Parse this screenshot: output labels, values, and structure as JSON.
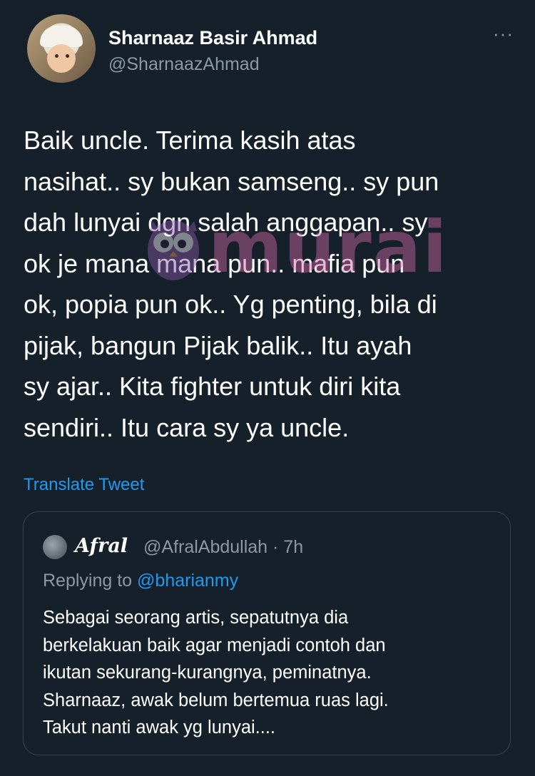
{
  "tweet": {
    "author_name": "Sharnaaz Basir Ahmad",
    "author_handle": "@SharnaazAhmad",
    "more_icon": "more-icon",
    "lines": [
      "Baik uncle. Terima kasih atas",
      "nasihat.. sy bukan samseng.. sy pun",
      "dah lunyai dgn salah anggapan.. sy",
      "ok je mana mana pun.. mafia pun",
      "ok, popia pun ok.. Yg penting, bila di",
      "pijak, bangun Pijak balik.. Itu ayah",
      "sy ajar.. Kita fighter untuk diri kita",
      "sendiri.. Itu cara sy ya uncle."
    ],
    "translate_label": "Translate Tweet"
  },
  "watermark": {
    "text": "murai",
    "color": "#d46ba8"
  },
  "quoted": {
    "author_name": "Afral",
    "author_meta": "@AfralAbdullah · 7h",
    "replying_prefix": "Replying to",
    "replying_mention": "@bharianmy",
    "lines": [
      "Sebagai seorang artis, sepatutnya dia",
      "berkelakuan baik agar menjadi contoh dan",
      "ikutan sekurang-kurangnya, peminatnya.",
      "Sharnaaz, awak belum bertemua ruas lagi.",
      "Takut nanti awak yg lunyai...."
    ]
  },
  "colors": {
    "background": "#15202b",
    "text": "#ffffff",
    "secondary": "#8b98a5",
    "link": "#1d9bf0",
    "border": "#38444d"
  }
}
